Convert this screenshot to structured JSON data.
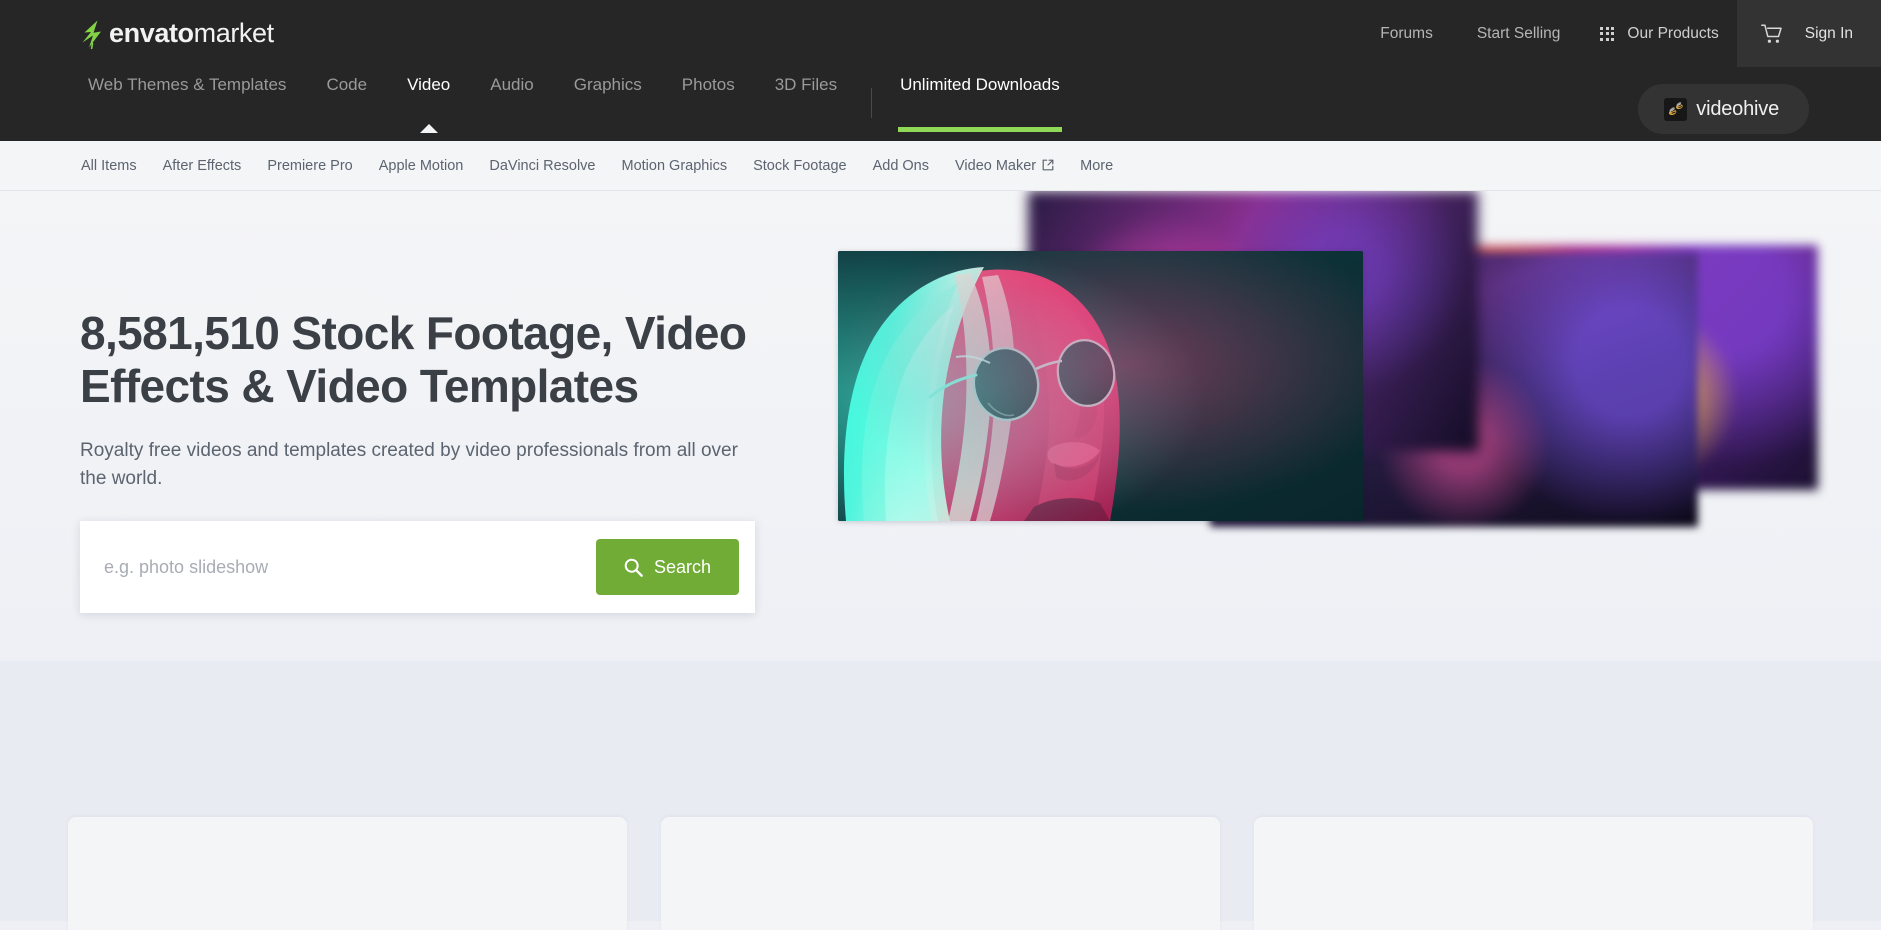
{
  "brand": {
    "logo_bold": "envato",
    "logo_light": "market",
    "logo_accent_color": "#82d445"
  },
  "topbar": {
    "links": [
      {
        "label": "Forums",
        "name": "forums"
      },
      {
        "label": "Start Selling",
        "name": "start-selling"
      }
    ],
    "our_products_label": "Our Products",
    "sign_in_label": "Sign In",
    "cart_icon": "shopping-cart-icon",
    "grid_icon": "apps-grid-icon"
  },
  "mainnav": {
    "items": [
      {
        "label": "Web Themes & Templates",
        "active": false
      },
      {
        "label": "Code",
        "active": false
      },
      {
        "label": "Video",
        "active": true
      },
      {
        "label": "Audio",
        "active": false
      },
      {
        "label": "Graphics",
        "active": false
      },
      {
        "label": "Photos",
        "active": false
      },
      {
        "label": "3D Files",
        "active": false
      }
    ],
    "unlimited_label": "Unlimited Downloads",
    "active_underline_color": "#8fd957",
    "brand_pill": {
      "label": "videohive",
      "icon": "bee-icon"
    }
  },
  "subnav": {
    "items": [
      {
        "label": "All Items",
        "external": false
      },
      {
        "label": "After Effects",
        "external": false
      },
      {
        "label": "Premiere Pro",
        "external": false
      },
      {
        "label": "Apple Motion",
        "external": false
      },
      {
        "label": "DaVinci Resolve",
        "external": false
      },
      {
        "label": "Motion Graphics",
        "external": false
      },
      {
        "label": "Stock Footage",
        "external": false
      },
      {
        "label": "Add Ons",
        "external": false
      },
      {
        "label": "Video Maker",
        "external": true
      },
      {
        "label": "More",
        "external": false
      }
    ]
  },
  "hero": {
    "title": "8,581,510 Stock Footage, Video Effects & Video Templates",
    "item_count": "8,581,510",
    "subtitle": "Royalty free videos and templates created by video professionals from all over the world.",
    "search": {
      "placeholder": "e.g. photo slideshow",
      "value": "",
      "button_label": "Search",
      "button_icon": "search-icon",
      "button_color": "#71ac36"
    }
  },
  "colors": {
    "nav_dark": "#262626",
    "topbar_dark": "#262626",
    "page_bg": "#eef0f5",
    "accent_green": "#82d445",
    "search_green": "#71ac36",
    "text_dark": "#3b3f46",
    "text_muted": "#5c6470"
  }
}
